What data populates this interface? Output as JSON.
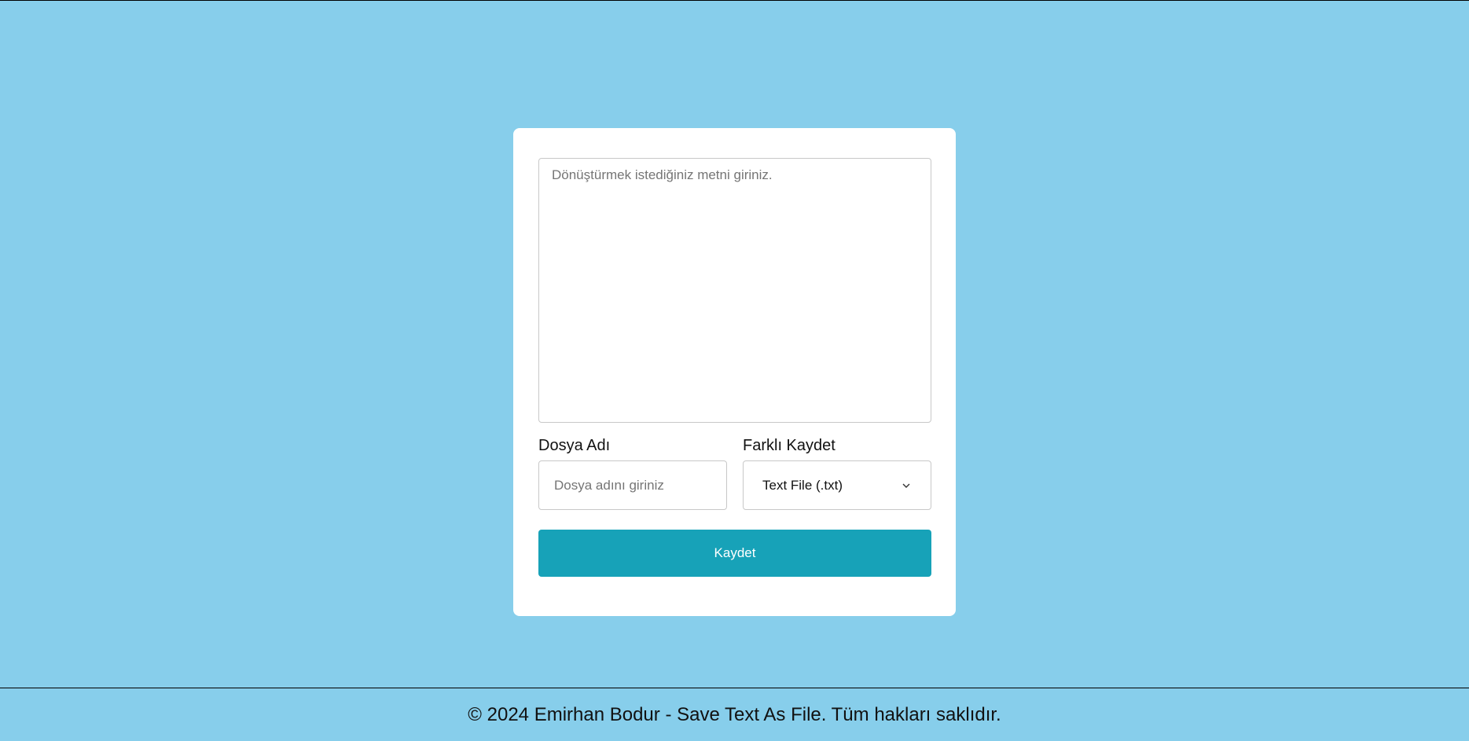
{
  "form": {
    "textarea_placeholder": "Dönüştürmek istediğiniz metni giriniz.",
    "filename_label": "Dosya Adı",
    "filename_placeholder": "Dosya adını giriniz",
    "format_label": "Farklı Kaydet",
    "format_selected": "Text File (.txt)",
    "save_label": "Kaydet"
  },
  "footer": {
    "text": "© 2024 Emirhan Bodur - Save Text As File. Tüm hakları saklıdır."
  },
  "colors": {
    "background": "#87ceeb",
    "card": "#ffffff",
    "button": "#17a2b8",
    "button_text": "#ffffff"
  },
  "icons": {
    "select_arrow": "chevron-down-icon"
  }
}
